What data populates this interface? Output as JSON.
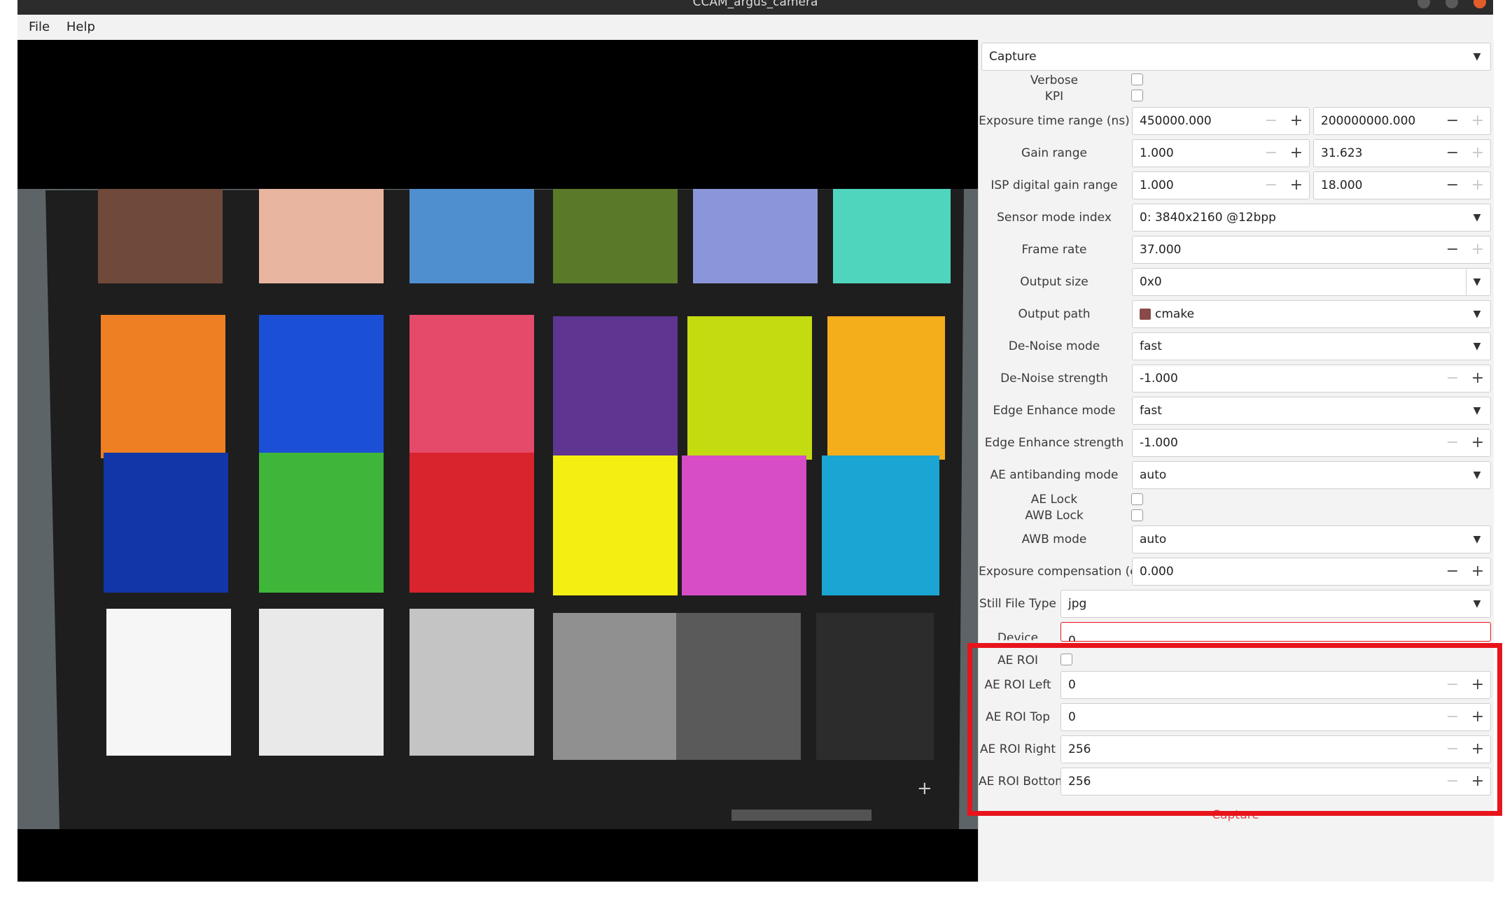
{
  "window": {
    "title": "CCAM_argus_camera"
  },
  "menu": {
    "file": "File",
    "help": "Help"
  },
  "panel": {
    "section": "Capture",
    "verbose": "Verbose",
    "kpi": "KPI",
    "exposure_label": "Exposure time range (ns)",
    "exposure_min": "450000.000",
    "exposure_max": "200000000.000",
    "gain_label": "Gain range",
    "gain_min": "1.000",
    "gain_max": "31.623",
    "isp_label": "ISP digital gain range",
    "isp_min": "1.000",
    "isp_max": "18.000",
    "sensor_label": "Sensor mode index",
    "sensor_value": "0: 3840x2160 @12bpp",
    "framerate_label": "Frame rate",
    "framerate_value": "37.000",
    "outsize_label": "Output size",
    "outsize_value": "0x0",
    "outpath_label": "Output path",
    "outpath_value": "cmake",
    "denoise_mode_label": "De-Noise mode",
    "denoise_mode_value": "fast",
    "denoise_strength_label": "De-Noise strength",
    "denoise_strength_value": "-1.000",
    "edge_mode_label": "Edge Enhance mode",
    "edge_mode_value": "fast",
    "edge_strength_label": "Edge Enhance strength",
    "edge_strength_value": "-1.000",
    "antibanding_label": "AE antibanding mode",
    "antibanding_value": "auto",
    "ae_lock": "AE Lock",
    "awb_lock": "AWB Lock",
    "awb_mode_label": "AWB mode",
    "awb_mode_value": "auto",
    "exp_comp_label": "Exposure compensation (ev)",
    "exp_comp_value": "0.000",
    "still_label": "Still File Type",
    "still_value": "jpg",
    "device_label": "Device",
    "device_value": "0",
    "ae_roi": "AE ROI",
    "roi_left_label": "AE ROI Left",
    "roi_left_value": "0",
    "roi_top_label": "AE ROI Top",
    "roi_top_value": "0",
    "roi_right_label": "AE ROI Right",
    "roi_right_value": "256",
    "roi_bottom_label": "AE ROI Bottom",
    "roi_bottom_value": "256",
    "capture_button": "Capture"
  },
  "colors": {
    "highlight": "#e8141c",
    "patches": [
      "#6f4a3b",
      "#e8b5a0",
      "#4f8fcf",
      "#5a7a2a",
      "#8a96d9",
      "#4fd5be",
      "#ee7f22",
      "#1b4fd6",
      "#e64a6a",
      "#5e3590",
      "#c3dc12",
      "#f4ad1b",
      "#1236a8",
      "#3fb53a",
      "#d9232d",
      "#f5ee12",
      "#d64dc5",
      "#1aa5d2",
      "#f6f6f6",
      "#e9e9e9",
      "#c4c4c4",
      "#909090",
      "#5a5a5a",
      "#2c2c2c"
    ]
  }
}
